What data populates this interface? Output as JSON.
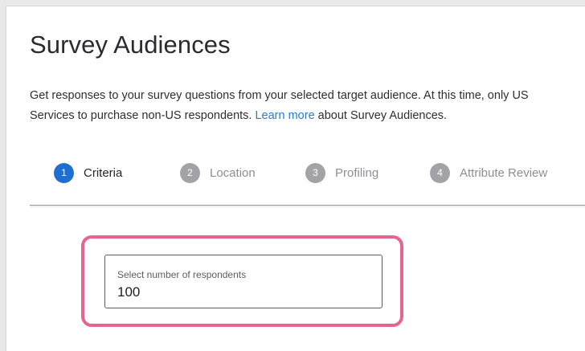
{
  "page": {
    "title": "Survey Audiences",
    "description_line1": "Get responses to your survey questions from your selected target audience. At this time, only US",
    "description_line2_before": "Services to purchase non-US respondents. ",
    "learn_more_link": "Learn more",
    "description_line2_after": " about Survey Audiences."
  },
  "steps": [
    {
      "number": "1",
      "label": "Criteria",
      "state": "active"
    },
    {
      "number": "2",
      "label": "Location",
      "state": "inactive"
    },
    {
      "number": "3",
      "label": "Profiling",
      "state": "inactive"
    },
    {
      "number": "4",
      "label": "Attribute Review",
      "state": "inactive"
    }
  ],
  "respondents_field": {
    "label": "Select number of respondents",
    "value": "100"
  },
  "colors": {
    "active_step": "#1f6fd1",
    "inactive_step": "#a3a3a6",
    "link": "#2a7bcf",
    "highlight_border": "#e9638f"
  }
}
